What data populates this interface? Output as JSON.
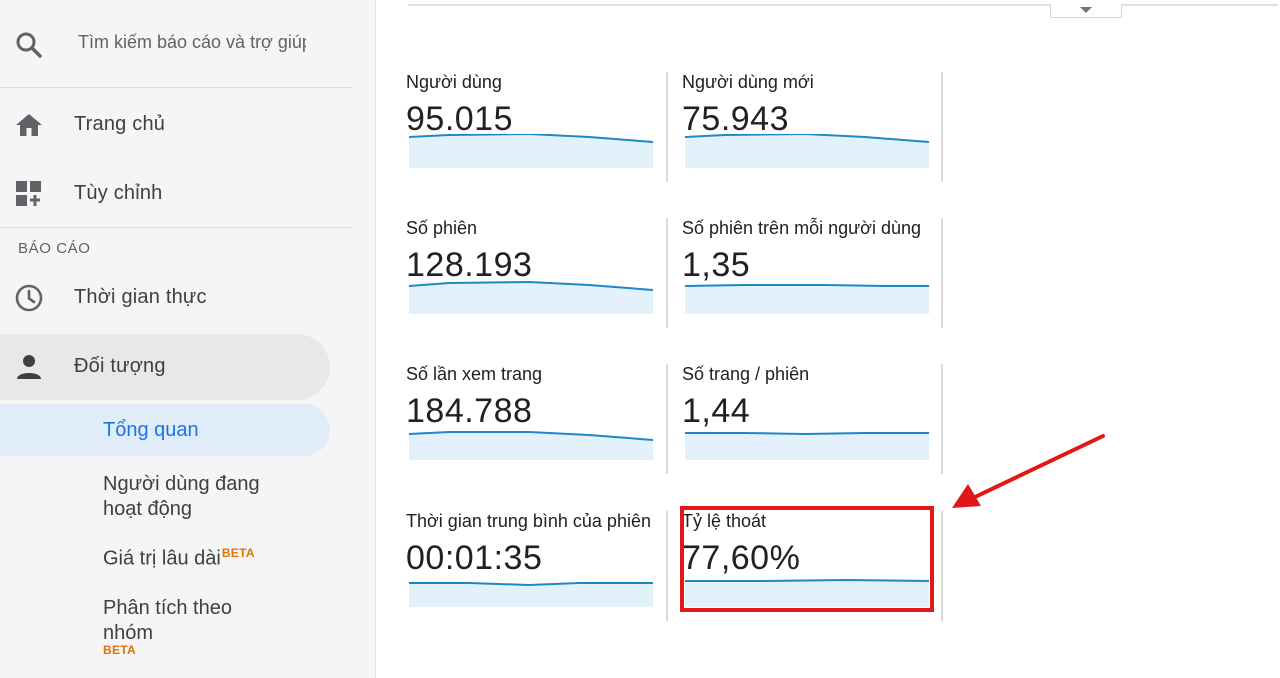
{
  "sidebar": {
    "search_placeholder": "Tìm kiếm báo cáo và trợ giúp",
    "nav": {
      "home": "Trang chủ",
      "customize": "Tùy chỉnh"
    },
    "section_title": "BÁO CÁO",
    "reports": {
      "realtime": "Thời gian thực",
      "audience": "Đối tượng"
    },
    "audience_children": [
      {
        "label": "Tổng quan",
        "beta": ""
      },
      {
        "label": "Người dùng đang hoạt động",
        "beta": ""
      },
      {
        "label": "Giá trị lâu dài",
        "beta": "BETA"
      },
      {
        "label": "Phân tích theo nhóm",
        "beta": "BETA"
      }
    ]
  },
  "metrics": [
    {
      "label": "Người dùng",
      "value": "95.015"
    },
    {
      "label": "Người dùng mới",
      "value": "75.943"
    },
    {
      "label": "Số phiên",
      "value": "128.193"
    },
    {
      "label": "Số phiên trên mỗi người dùng",
      "value": "1,35"
    },
    {
      "label": "Số lần xem trang",
      "value": "184.788"
    },
    {
      "label": "Số trang / phiên",
      "value": "1,44"
    },
    {
      "label": "Thời gian trung bình của phiên",
      "value": "00:01:35"
    },
    {
      "label": "Tỷ lệ thoát",
      "value": "77,60%"
    }
  ],
  "colors": {
    "sparkline_line": "#1e88c7",
    "sparkline_fill": "#e3f2fa",
    "highlight": "#e01818",
    "active_item": "#1a73e8",
    "beta": "#e37400"
  }
}
